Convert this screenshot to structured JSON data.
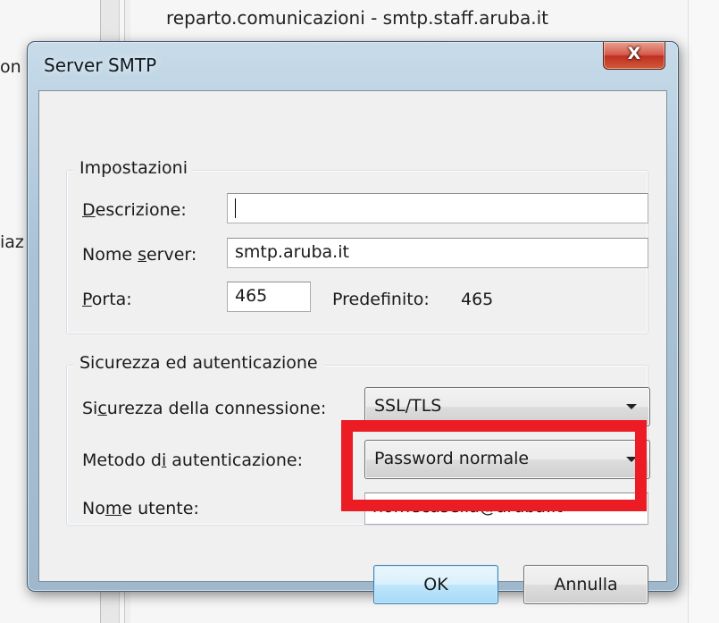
{
  "background_window": {
    "title": "reparto.comunicazioni - smtp.staff.aruba.it",
    "left_fragment_1": "on",
    "left_fragment_2": "iaz"
  },
  "dialog": {
    "title": "Server SMTP",
    "close_glyph": "X",
    "close_icon": "close-icon",
    "settings": {
      "legend": "Impostazioni",
      "description": {
        "label_u": "D",
        "label_rest": "escrizione:",
        "value": ""
      },
      "server_name": {
        "label_pre": "Nome ",
        "label_u": "s",
        "label_rest": "erver:",
        "value": "smtp.aruba.it"
      },
      "port": {
        "label_u": "P",
        "label_rest": "orta:",
        "value": "465"
      },
      "default_port": {
        "label": "Predefinito:",
        "value": "465"
      }
    },
    "security": {
      "legend": "Sicurezza ed autenticazione",
      "connection_security": {
        "label_pre": "Si",
        "label_u": "c",
        "label_rest": "urezza della connessione:",
        "value": "SSL/TLS"
      },
      "auth_method": {
        "label_pre": "Metodo d",
        "label_u": "i",
        "label_rest": " autenticazione:",
        "value": "Password normale"
      },
      "username": {
        "label_pre": "No",
        "label_u": "m",
        "label_rest": "e utente:",
        "value": "nomecasella@aruba.it"
      }
    },
    "buttons": {
      "ok": "OK",
      "cancel": "Annulla"
    },
    "highlight_color": "#ec1c24",
    "accent_color": "#3c7fb1"
  }
}
